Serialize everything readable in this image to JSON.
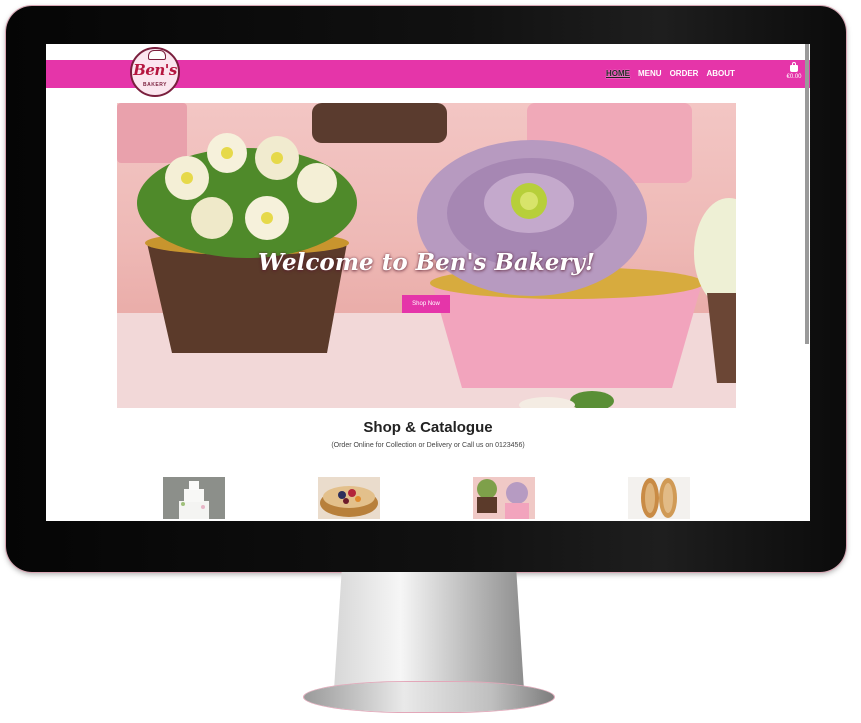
{
  "brand": {
    "logo_text": "Ben's",
    "logo_subtext": "BAKERY"
  },
  "nav": {
    "links": [
      "HOME",
      "MENU",
      "ORDER",
      "ABOUT"
    ],
    "active": "HOME"
  },
  "cart": {
    "icon": "shopping-bag-icon",
    "total": "€0.00"
  },
  "hero": {
    "title": "Welcome to Ben's Bakery!",
    "button_label": "Shop Now"
  },
  "shop": {
    "title": "Shop & Catalogue",
    "subtitle": "(Order Online for Collection or Delivery or Call us on 0123456)"
  },
  "colors": {
    "accent": "#e535a9",
    "logo_red": "#b5163f"
  }
}
